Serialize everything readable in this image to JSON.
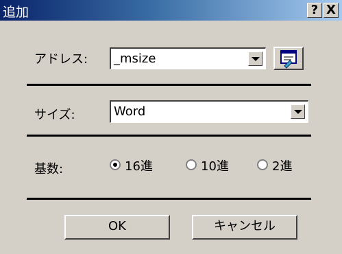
{
  "window": {
    "title": "追加",
    "help_glyph": "?",
    "close_glyph": "X"
  },
  "address": {
    "label": "アドレス:",
    "value": "_msize"
  },
  "size": {
    "label": "サイズ:",
    "value": "Word"
  },
  "base": {
    "label": "基数:",
    "options": [
      {
        "label": "16進",
        "selected": true
      },
      {
        "label": "10進",
        "selected": false
      },
      {
        "label": "2進",
        "selected": false
      }
    ]
  },
  "buttons": {
    "ok": "OK",
    "cancel": "キャンセル"
  },
  "icons": {
    "address_dropdown": "chevron-down-icon",
    "size_dropdown": "chevron-down-icon",
    "address_picker": "symbol-browse-icon"
  }
}
